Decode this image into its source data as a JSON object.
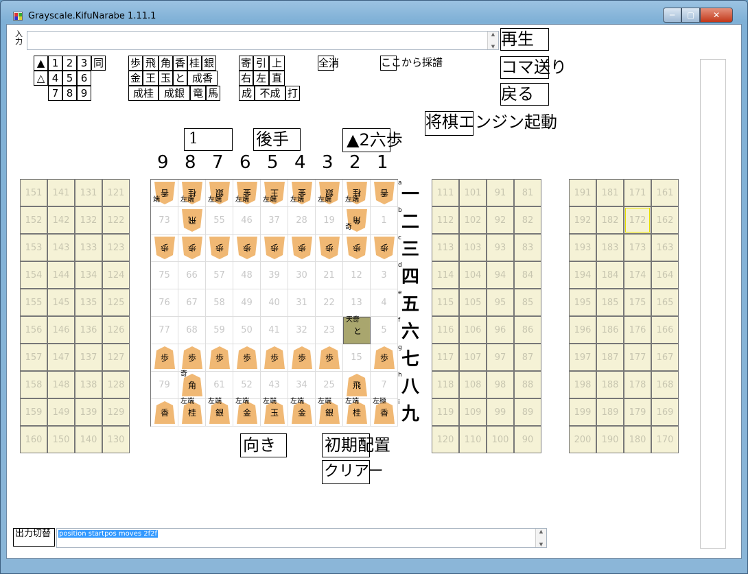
{
  "window": {
    "title": "Grayscale.KifuNarabe 1.11.1",
    "min": "─",
    "max": "▢",
    "close": "✕"
  },
  "input": {
    "label": "入力",
    "value": "",
    "up": "▲",
    "down": "▼"
  },
  "buttons": {
    "play": "再生",
    "step": "コマ送り",
    "back": "戻る",
    "engine": "将棋エンジン起動",
    "orient": "向き",
    "init": "初期配置",
    "clear": "クリアー",
    "from_here": "ここから採譜",
    "all_clear": "全消"
  },
  "turn_marks": {
    "sente": "▲",
    "gote": "△"
  },
  "digits_row1": [
    "1",
    "2",
    "3",
    "同"
  ],
  "digits_row2": [
    "4",
    "5",
    "6"
  ],
  "digits_row3": [
    "7",
    "8",
    "9"
  ],
  "pieces_row1": [
    "歩",
    "飛",
    "角",
    "香",
    "桂",
    "銀"
  ],
  "pieces_row2": [
    "金",
    "王",
    "玉",
    "と",
    "成香"
  ],
  "pieces_row3": [
    "成桂",
    "成銀",
    "竜",
    "馬"
  ],
  "move_mods_row1": [
    "寄",
    "引",
    "上"
  ],
  "move_mods_row2": [
    "右",
    "左",
    "直"
  ],
  "move_mods_row3": [
    "成",
    "不成",
    "打"
  ],
  "status": {
    "move_number": "1",
    "side": "後手",
    "move": "▲2六歩"
  },
  "file_labels": [
    "9",
    "8",
    "7",
    "6",
    "5",
    "4",
    "3",
    "2",
    "1"
  ],
  "rank_labels": [
    "一",
    "二",
    "三",
    "四",
    "五",
    "六",
    "七",
    "八",
    "九"
  ],
  "rank_letters": [
    "a",
    "b",
    "c",
    "d",
    "e",
    "f",
    "g",
    "h",
    "i"
  ],
  "board_numbers": [
    [
      "",
      "",
      "",
      "",
      "",
      "",
      "",
      "",
      ""
    ],
    [
      "73",
      "",
      "55",
      "46",
      "37",
      "28",
      "19",
      "",
      "1"
    ],
    [
      "",
      "",
      "",
      "",
      "",
      "",
      "",
      "",
      ""
    ],
    [
      "75",
      "66",
      "57",
      "48",
      "39",
      "30",
      "21",
      "12",
      "3"
    ],
    [
      "76",
      "67",
      "58",
      "49",
      "40",
      "31",
      "22",
      "13",
      "4"
    ],
    [
      "77",
      "68",
      "59",
      "50",
      "41",
      "32",
      "23",
      "",
      "5"
    ],
    [
      "",
      "",
      "",
      "",
      "",
      "",
      "",
      "15",
      ""
    ],
    [
      "79",
      "",
      "61",
      "52",
      "43",
      "34",
      "25",
      "",
      "7"
    ],
    [
      "",
      "",
      "",
      "",
      "",
      "",
      "",
      "",
      ""
    ],
    [
      "",
      "",
      "",
      "",
      "",
      "",
      "",
      "",
      ""
    ]
  ],
  "pieces": [
    {
      "r": 0,
      "c": 0,
      "ch": "香",
      "gote": true,
      "note": "端"
    },
    {
      "r": 0,
      "c": 1,
      "ch": "桂",
      "gote": true,
      "note": "左端"
    },
    {
      "r": 0,
      "c": 2,
      "ch": "銀",
      "gote": true,
      "note": "左端"
    },
    {
      "r": 0,
      "c": 3,
      "ch": "金",
      "gote": true,
      "note": "左端"
    },
    {
      "r": 0,
      "c": 4,
      "ch": "王",
      "gote": true,
      "note": "左端"
    },
    {
      "r": 0,
      "c": 5,
      "ch": "金",
      "gote": true,
      "note": "左端"
    },
    {
      "r": 0,
      "c": 6,
      "ch": "銀",
      "gote": true,
      "note": "左端"
    },
    {
      "r": 0,
      "c": 7,
      "ch": "桂",
      "gote": true,
      "note": "左端"
    },
    {
      "r": 0,
      "c": 8,
      "ch": "香",
      "gote": true,
      "note": ""
    },
    {
      "r": 1,
      "c": 1,
      "ch": "飛",
      "gote": true,
      "note": ""
    },
    {
      "r": 1,
      "c": 7,
      "ch": "角",
      "gote": true,
      "note": "奇"
    },
    {
      "r": 2,
      "c": 0,
      "ch": "歩",
      "gote": true,
      "note": ""
    },
    {
      "r": 2,
      "c": 1,
      "ch": "歩",
      "gote": true,
      "note": ""
    },
    {
      "r": 2,
      "c": 2,
      "ch": "歩",
      "gote": true,
      "note": ""
    },
    {
      "r": 2,
      "c": 3,
      "ch": "歩",
      "gote": true,
      "note": ""
    },
    {
      "r": 2,
      "c": 4,
      "ch": "歩",
      "gote": true,
      "note": ""
    },
    {
      "r": 2,
      "c": 5,
      "ch": "歩",
      "gote": true,
      "note": ""
    },
    {
      "r": 2,
      "c": 6,
      "ch": "歩",
      "gote": true,
      "note": ""
    },
    {
      "r": 2,
      "c": 7,
      "ch": "歩",
      "gote": true,
      "note": ""
    },
    {
      "r": 2,
      "c": 8,
      "ch": "歩",
      "gote": true,
      "note": ""
    },
    {
      "r": 5,
      "c": 7,
      "ch": "と",
      "gote": false,
      "note": "天奇",
      "hl": true
    },
    {
      "r": 6,
      "c": 0,
      "ch": "歩",
      "gote": false,
      "note": ""
    },
    {
      "r": 6,
      "c": 1,
      "ch": "歩",
      "gote": false,
      "note": ""
    },
    {
      "r": 6,
      "c": 2,
      "ch": "歩",
      "gote": false,
      "note": ""
    },
    {
      "r": 6,
      "c": 3,
      "ch": "歩",
      "gote": false,
      "note": ""
    },
    {
      "r": 6,
      "c": 4,
      "ch": "歩",
      "gote": false,
      "note": ""
    },
    {
      "r": 6,
      "c": 5,
      "ch": "歩",
      "gote": false,
      "note": ""
    },
    {
      "r": 6,
      "c": 6,
      "ch": "歩",
      "gote": false,
      "note": ""
    },
    {
      "r": 6,
      "c": 8,
      "ch": "歩",
      "gote": false,
      "note": ""
    },
    {
      "r": 7,
      "c": 1,
      "ch": "角",
      "gote": false,
      "note": "奇"
    },
    {
      "r": 7,
      "c": 7,
      "ch": "飛",
      "gote": false,
      "note": ""
    },
    {
      "r": 8,
      "c": 0,
      "ch": "香",
      "gote": false,
      "note": ""
    },
    {
      "r": 8,
      "c": 1,
      "ch": "桂",
      "gote": false,
      "note": "左端"
    },
    {
      "r": 8,
      "c": 2,
      "ch": "銀",
      "gote": false,
      "note": "左端"
    },
    {
      "r": 8,
      "c": 3,
      "ch": "金",
      "gote": false,
      "note": "左端"
    },
    {
      "r": 8,
      "c": 4,
      "ch": "玉",
      "gote": false,
      "note": "左端"
    },
    {
      "r": 8,
      "c": 5,
      "ch": "金",
      "gote": false,
      "note": "左端"
    },
    {
      "r": 8,
      "c": 6,
      "ch": "銀",
      "gote": false,
      "note": "左端"
    },
    {
      "r": 8,
      "c": 7,
      "ch": "桂",
      "gote": false,
      "note": "左端"
    },
    {
      "r": 8,
      "c": 8,
      "ch": "香",
      "gote": false,
      "note": "左極"
    }
  ],
  "left_stand": [
    [
      "151",
      "141",
      "131",
      "121"
    ],
    [
      "152",
      "142",
      "132",
      "122"
    ],
    [
      "153",
      "143",
      "133",
      "123"
    ],
    [
      "154",
      "144",
      "134",
      "124"
    ],
    [
      "155",
      "145",
      "135",
      "125"
    ],
    [
      "156",
      "146",
      "136",
      "126"
    ],
    [
      "157",
      "147",
      "137",
      "127"
    ],
    [
      "158",
      "148",
      "138",
      "128"
    ],
    [
      "159",
      "149",
      "139",
      "129"
    ],
    [
      "160",
      "150",
      "140",
      "130"
    ]
  ],
  "mid_stand": [
    [
      "111",
      "101",
      "91",
      "81"
    ],
    [
      "112",
      "102",
      "92",
      "82"
    ],
    [
      "113",
      "103",
      "93",
      "83"
    ],
    [
      "114",
      "104",
      "94",
      "84"
    ],
    [
      "115",
      "105",
      "95",
      "85"
    ],
    [
      "116",
      "106",
      "96",
      "86"
    ],
    [
      "117",
      "107",
      "97",
      "87"
    ],
    [
      "118",
      "108",
      "98",
      "88"
    ],
    [
      "119",
      "109",
      "99",
      "89"
    ],
    [
      "120",
      "110",
      "100",
      "90"
    ]
  ],
  "right_stand": [
    [
      "191",
      "181",
      "171",
      "161"
    ],
    [
      "192",
      "182",
      "172",
      "162"
    ],
    [
      "193",
      "183",
      "173",
      "163"
    ],
    [
      "194",
      "184",
      "174",
      "164"
    ],
    [
      "195",
      "185",
      "175",
      "165"
    ],
    [
      "196",
      "186",
      "176",
      "166"
    ],
    [
      "197",
      "187",
      "177",
      "167"
    ],
    [
      "198",
      "188",
      "178",
      "168"
    ],
    [
      "199",
      "189",
      "179",
      "169"
    ],
    [
      "200",
      "190",
      "180",
      "170"
    ]
  ],
  "output": {
    "label": "出力切替",
    "value": "position startpos moves 2f2f"
  }
}
